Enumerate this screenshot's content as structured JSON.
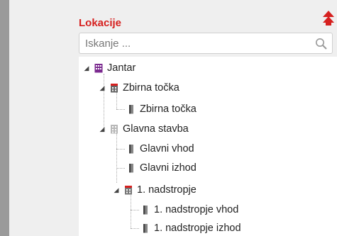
{
  "panel": {
    "title": "Lokacije",
    "colors": {
      "title": "#d6201f",
      "building_icon": "#7b2a8f",
      "device_icon": "#555555"
    }
  },
  "search": {
    "placeholder": "Iskanje ...",
    "value": ""
  },
  "tree": {
    "root": {
      "label": "Jantar",
      "icon": "building-purple-icon",
      "expanded": true
    },
    "zbirna": {
      "label": "Zbirna točka",
      "icon": "building-red-icon",
      "expanded": true
    },
    "zbirna_child": {
      "label": "Zbirna točka",
      "icon": "device-icon"
    },
    "glavna": {
      "label": "Glavna stavba",
      "icon": "building-gray-icon",
      "expanded": true
    },
    "glavni_vhod": {
      "label": "Glavni vhod",
      "icon": "device-icon"
    },
    "glavni_izhod": {
      "label": "Glavni izhod",
      "icon": "device-icon"
    },
    "nadstropje": {
      "label": "1. nadstropje",
      "icon": "building-red-icon",
      "expanded": true
    },
    "nadstropje_vhod": {
      "label": "1. nadstropje vhod",
      "icon": "device-icon"
    },
    "nadstropje_izhod": {
      "label": "1. nadstropje izhod",
      "icon": "device-icon"
    }
  }
}
